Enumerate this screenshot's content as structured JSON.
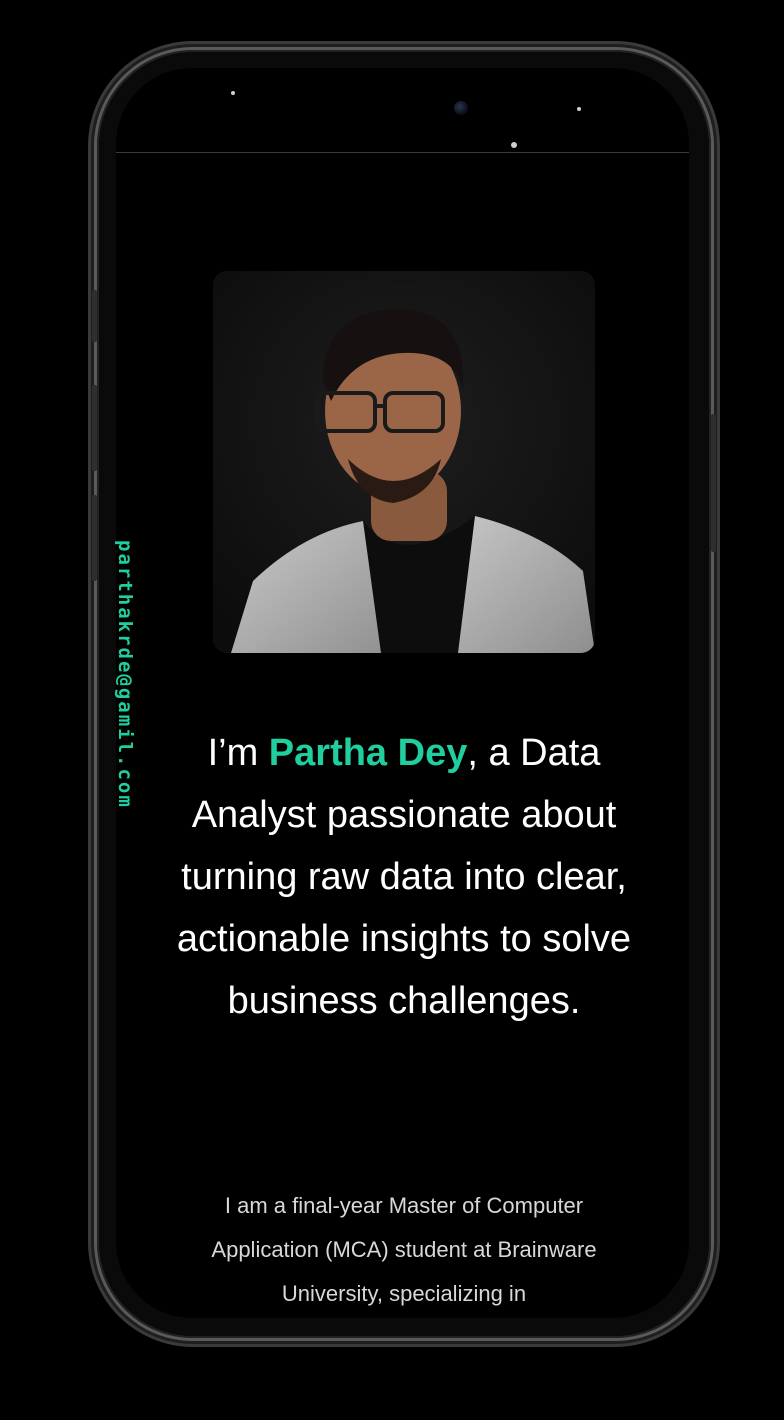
{
  "profile": {
    "email": "parthakrde@gamil.com",
    "photo_alt": "Portrait of Partha Dey"
  },
  "hero": {
    "prefix": "I’m ",
    "name": "Partha Dey",
    "rest": ", a Data Analyst passionate about turning raw data into clear, actionable insights to solve business challenges."
  },
  "about": {
    "text": "I am a final-year Master of Computer Application (MCA) student at Brainware University, specializing in"
  },
  "colors": {
    "accent": "#1fcf9f",
    "background": "#000000",
    "text": "#ffffff"
  }
}
